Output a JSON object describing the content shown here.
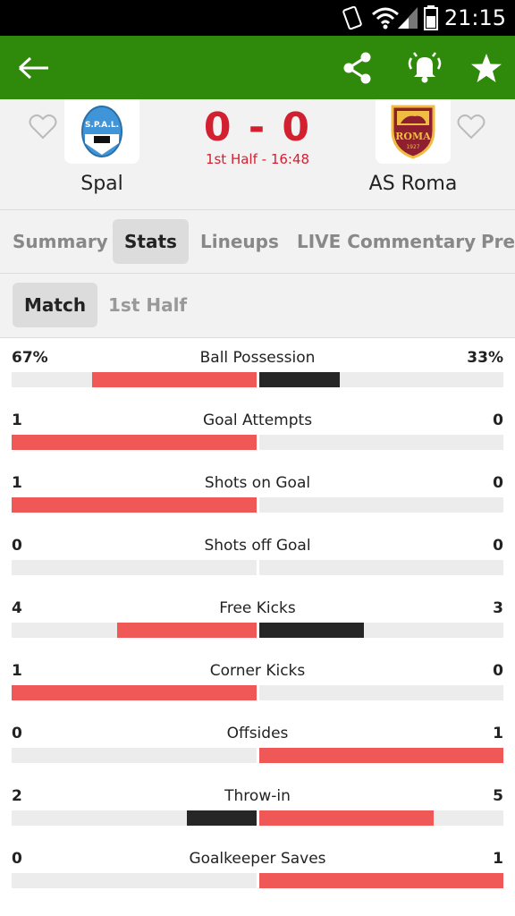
{
  "statusbar": {
    "time": "21:15"
  },
  "appbar": {
    "back_icon": "arrow-left-icon",
    "share_icon": "share-icon",
    "alert_icon": "alarm-bell-icon",
    "favorite_icon": "star-icon"
  },
  "match": {
    "home": {
      "name": "Spal",
      "logo_text": "S.P.A.L."
    },
    "away": {
      "name": "AS Roma",
      "logo_text": "ROMA",
      "logo_year": "1927"
    },
    "score": "0 - 0",
    "time": "1st Half - 16:48"
  },
  "tabs": [
    "Summary",
    "Stats",
    "Lineups",
    "LIVE Commentary",
    "Pre"
  ],
  "subtabs": [
    "Match",
    "1st Half"
  ],
  "colors": {
    "green": "#2f8a0c",
    "red_bar": "#f05757",
    "dark_bar": "#262626",
    "score_red": "#d32030"
  },
  "stats": [
    {
      "label": "Ball Possession",
      "home": "67%",
      "away": "33%",
      "home_share": 0.67,
      "away_share": 0.33,
      "leader": "home"
    },
    {
      "label": "Goal Attempts",
      "home": "1",
      "away": "0",
      "home_share": 1,
      "away_share": 0,
      "leader": "home"
    },
    {
      "label": "Shots on Goal",
      "home": "1",
      "away": "0",
      "home_share": 1,
      "away_share": 0,
      "leader": "home"
    },
    {
      "label": "Shots off Goal",
      "home": "0",
      "away": "0",
      "home_share": 0,
      "away_share": 0,
      "leader": "none"
    },
    {
      "label": "Free Kicks",
      "home": "4",
      "away": "3",
      "home_share": 0.571,
      "away_share": 0.429,
      "leader": "home"
    },
    {
      "label": "Corner Kicks",
      "home": "1",
      "away": "0",
      "home_share": 1,
      "away_share": 0,
      "leader": "home"
    },
    {
      "label": "Offsides",
      "home": "0",
      "away": "1",
      "home_share": 0,
      "away_share": 1,
      "leader": "away"
    },
    {
      "label": "Throw-in",
      "home": "2",
      "away": "5",
      "home_share": 0.286,
      "away_share": 0.714,
      "leader": "away"
    },
    {
      "label": "Goalkeeper Saves",
      "home": "0",
      "away": "1",
      "home_share": 0,
      "away_share": 1,
      "leader": "away"
    }
  ]
}
